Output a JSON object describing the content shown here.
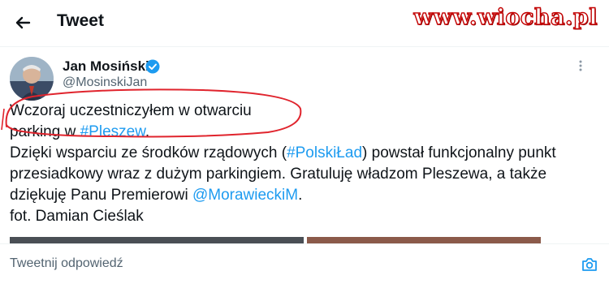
{
  "header": {
    "title": "Tweet",
    "watermark": "www.wiocha.pl"
  },
  "tweet": {
    "author_name": "Jan Mosiński",
    "author_handle": "@MosinskiJan",
    "more_label": "·",
    "text_1": "Wczoraj uczestniczyłem w otwarciu\nparking w ",
    "hashtag_1": "#Pleszew",
    "text_2": ".\nDzięki wsparciu ze środków rządowych (",
    "hashtag_2": "#PolskiŁad",
    "text_3": ") powstał funkcjonalny punkt\nprzesiadkowy wraz z dużym parkingiem. Gratuluję władzom Pleszewa, a także\ndziękuję Panu Premierowi ",
    "mention_1": "@MorawieckiM",
    "text_4": ".\nfot. Damian Cieślak"
  },
  "reply": {
    "placeholder": "Tweetnij odpowiedź"
  },
  "colors": {
    "link": "#1d9bf0",
    "verified": "#1d9bf0",
    "annotation": "#e0242d"
  },
  "icons": {
    "back": "arrow-left-icon",
    "verified": "verified-badge-icon",
    "camera": "camera-icon"
  }
}
